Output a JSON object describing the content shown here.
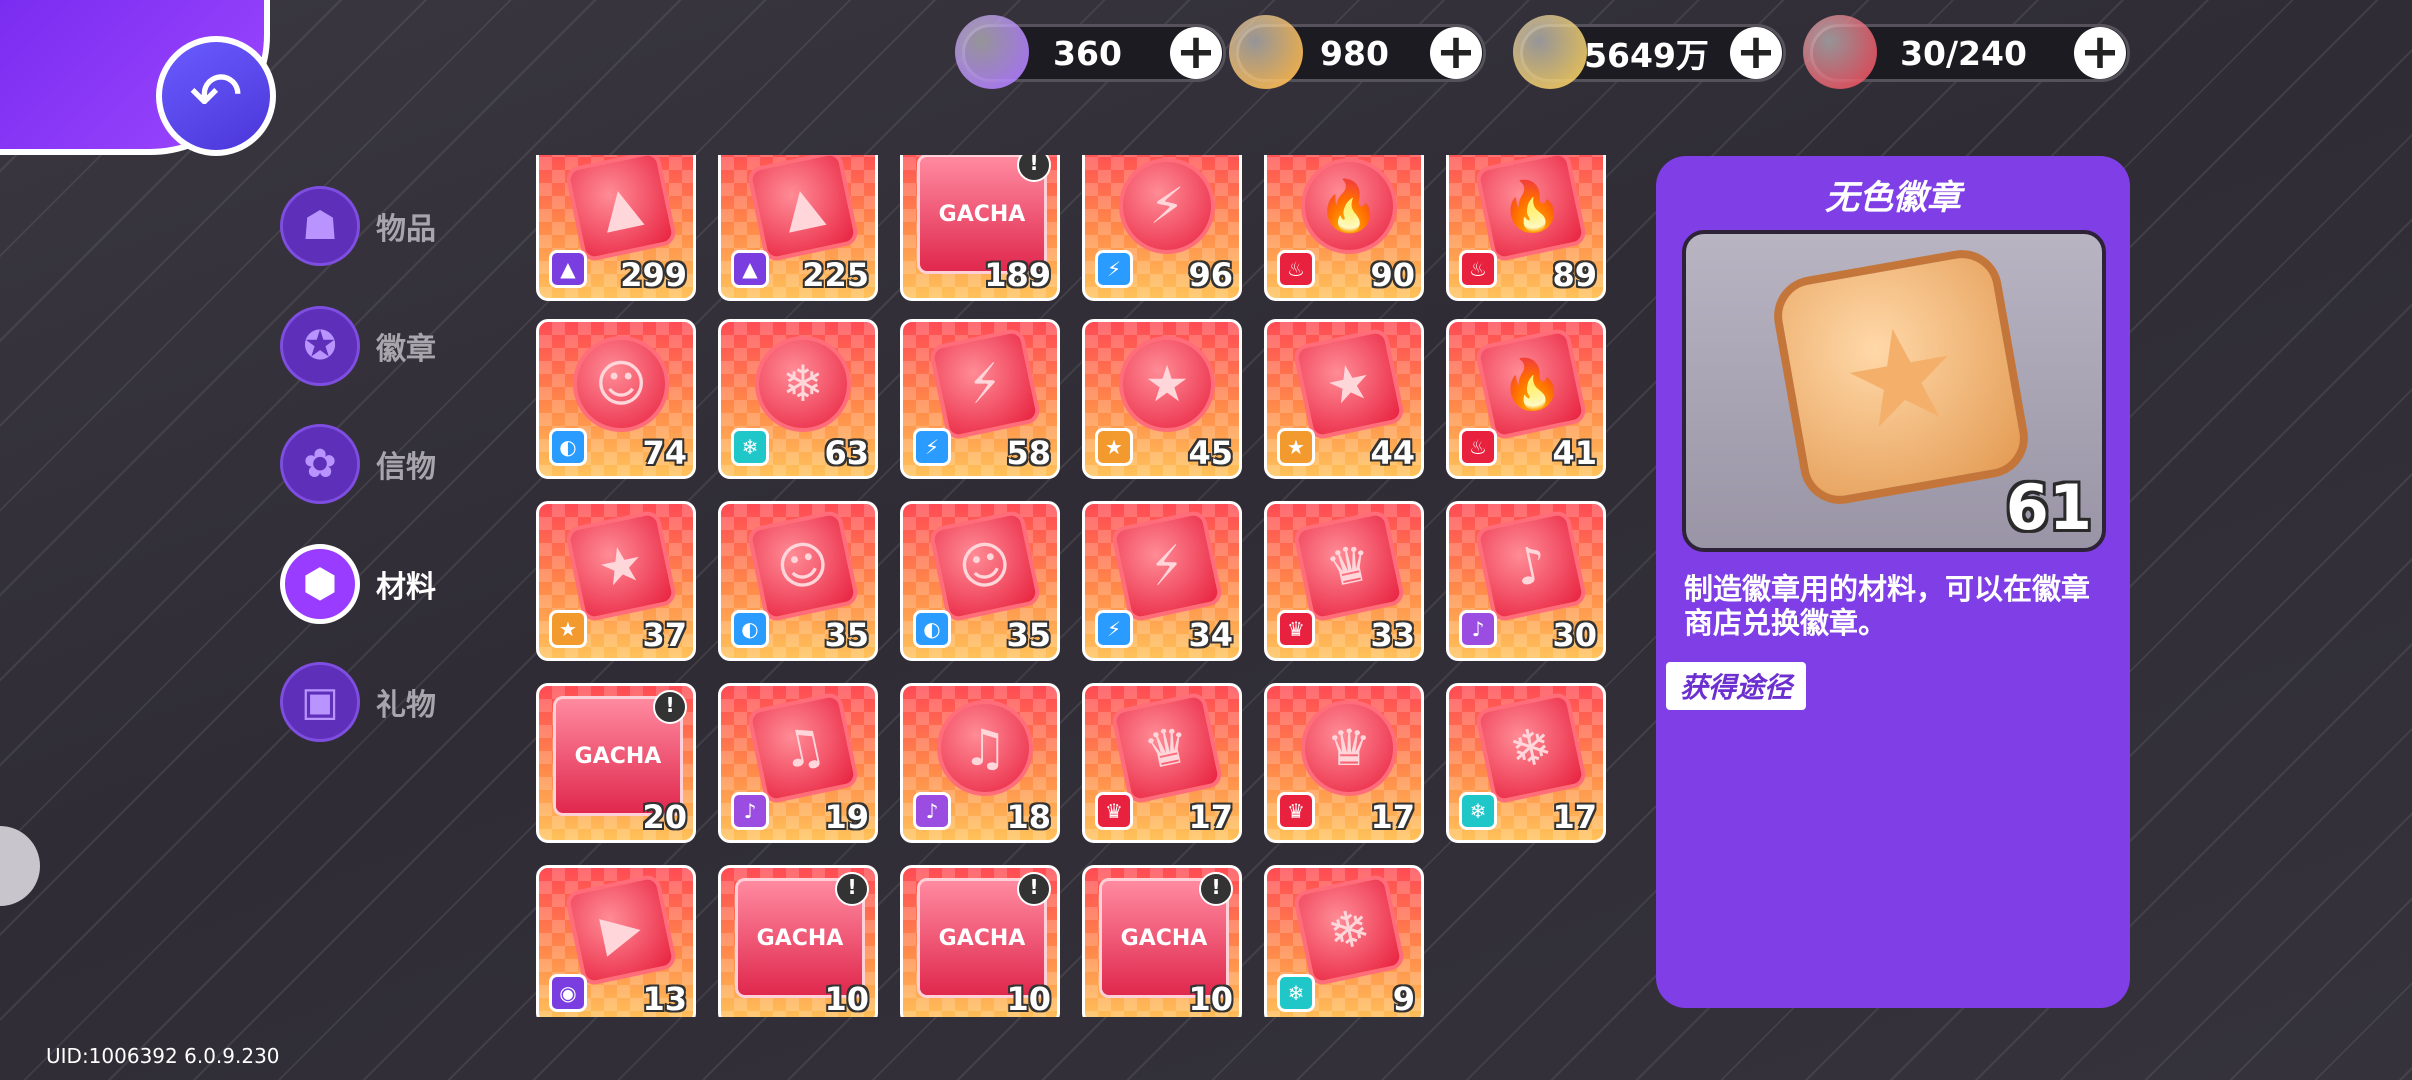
{
  "currencies": [
    {
      "name": "rainbow-cat-gem",
      "value": "360",
      "color": "#a66cff"
    },
    {
      "name": "cat-coin",
      "value": "980",
      "color": "#ffb33a"
    },
    {
      "name": "gold-coin",
      "value": "5649万",
      "color": "#f2c54c"
    },
    {
      "name": "stamina-cake",
      "value": "30/240",
      "color": "#e63a4b"
    }
  ],
  "menu": [
    {
      "label": "物品",
      "icon": "cat-bag-icon"
    },
    {
      "label": "徽章",
      "icon": "medal-icon"
    },
    {
      "label": "信物",
      "icon": "puzzle-icon"
    },
    {
      "label": "材料",
      "icon": "tag-icon",
      "active": true
    },
    {
      "label": "礼物",
      "icon": "gift-icon"
    }
  ],
  "items": [
    {
      "shape": "diamond",
      "glyph": "▲",
      "type_color": "#7a3de0",
      "type_glyph": "▲",
      "count": "299"
    },
    {
      "shape": "diamond",
      "glyph": "▲",
      "type_color": "#7a3de0",
      "type_glyph": "▲",
      "count": "225"
    },
    {
      "shape": "gacha",
      "glyph": "GACHA",
      "count": "189",
      "alert": true
    },
    {
      "shape": "circle",
      "glyph": "⚡",
      "type_color": "#2a9bff",
      "type_glyph": "⚡",
      "count": "96"
    },
    {
      "shape": "circle",
      "glyph": "🔥",
      "type_color": "#e8213f",
      "type_glyph": "♨",
      "count": "90"
    },
    {
      "shape": "diamond",
      "glyph": "🔥",
      "type_color": "#e8213f",
      "type_glyph": "♨",
      "count": "89"
    },
    {
      "shape": "circle",
      "glyph": "☺",
      "type_color": "#2a9bff",
      "type_glyph": "◐",
      "count": "74"
    },
    {
      "shape": "circle",
      "glyph": "❄",
      "type_color": "#1fc7c9",
      "type_glyph": "❄",
      "count": "63"
    },
    {
      "shape": "diamond",
      "glyph": "⚡",
      "type_color": "#2a9bff",
      "type_glyph": "⚡",
      "count": "58"
    },
    {
      "shape": "circle",
      "glyph": "★",
      "type_color": "#f29a2e",
      "type_glyph": "★",
      "count": "45"
    },
    {
      "shape": "diamond",
      "glyph": "★",
      "type_color": "#f29a2e",
      "type_glyph": "★",
      "count": "44"
    },
    {
      "shape": "diamond",
      "glyph": "🔥",
      "type_color": "#e8213f",
      "type_glyph": "♨",
      "count": "41"
    },
    {
      "shape": "diamond",
      "glyph": "★",
      "type_color": "#f29a2e",
      "type_glyph": "★",
      "count": "37"
    },
    {
      "shape": "diamond",
      "glyph": "☺",
      "type_color": "#2a9bff",
      "type_glyph": "◐",
      "count": "35"
    },
    {
      "shape": "diamond",
      "glyph": "☺",
      "type_color": "#2a9bff",
      "type_glyph": "◐",
      "count": "35"
    },
    {
      "shape": "diamond",
      "glyph": "⚡",
      "type_color": "#2a9bff",
      "type_glyph": "⚡",
      "count": "34"
    },
    {
      "shape": "diamond",
      "glyph": "♛",
      "type_color": "#e8213f",
      "type_glyph": "♛",
      "count": "33"
    },
    {
      "shape": "diamond",
      "glyph": "♪",
      "type_color": "#9a4de0",
      "type_glyph": "♪",
      "count": "30"
    },
    {
      "shape": "gacha",
      "glyph": "GACHA",
      "count": "20",
      "alert": true
    },
    {
      "shape": "diamond",
      "glyph": "♫",
      "type_color": "#9a4de0",
      "type_glyph": "♪",
      "count": "19"
    },
    {
      "shape": "circle",
      "glyph": "♫",
      "type_color": "#9a4de0",
      "type_glyph": "♪",
      "count": "18"
    },
    {
      "shape": "diamond",
      "glyph": "♛",
      "type_color": "#e8213f",
      "type_glyph": "♛",
      "count": "17"
    },
    {
      "shape": "circle",
      "glyph": "♛",
      "type_color": "#e8213f",
      "type_glyph": "♛",
      "count": "17"
    },
    {
      "shape": "diamond",
      "glyph": "❄",
      "type_color": "#1fc7c9",
      "type_glyph": "❄",
      "count": "17"
    },
    {
      "shape": "diamond",
      "glyph": "▶",
      "type_color": "#7a3de0",
      "type_glyph": "◉",
      "count": "13"
    },
    {
      "shape": "gacha",
      "glyph": "GACHA",
      "count": "10",
      "alert": true
    },
    {
      "shape": "gacha",
      "glyph": "GACHA",
      "count": "10",
      "alert": true
    },
    {
      "shape": "gacha",
      "glyph": "GACHA",
      "count": "10",
      "alert": true
    },
    {
      "shape": "diamond",
      "glyph": "❄",
      "type_color": "#1fc7c9",
      "type_glyph": "❄",
      "count": "9"
    }
  ],
  "detail": {
    "title": "无色徽章",
    "count": "61",
    "description": "制造徽章用的材料，可以在徽章商店兑换徽章。",
    "obtain_label": "获得途径"
  },
  "footer": {
    "uid": "UID:1006392 6.0.9.230"
  }
}
